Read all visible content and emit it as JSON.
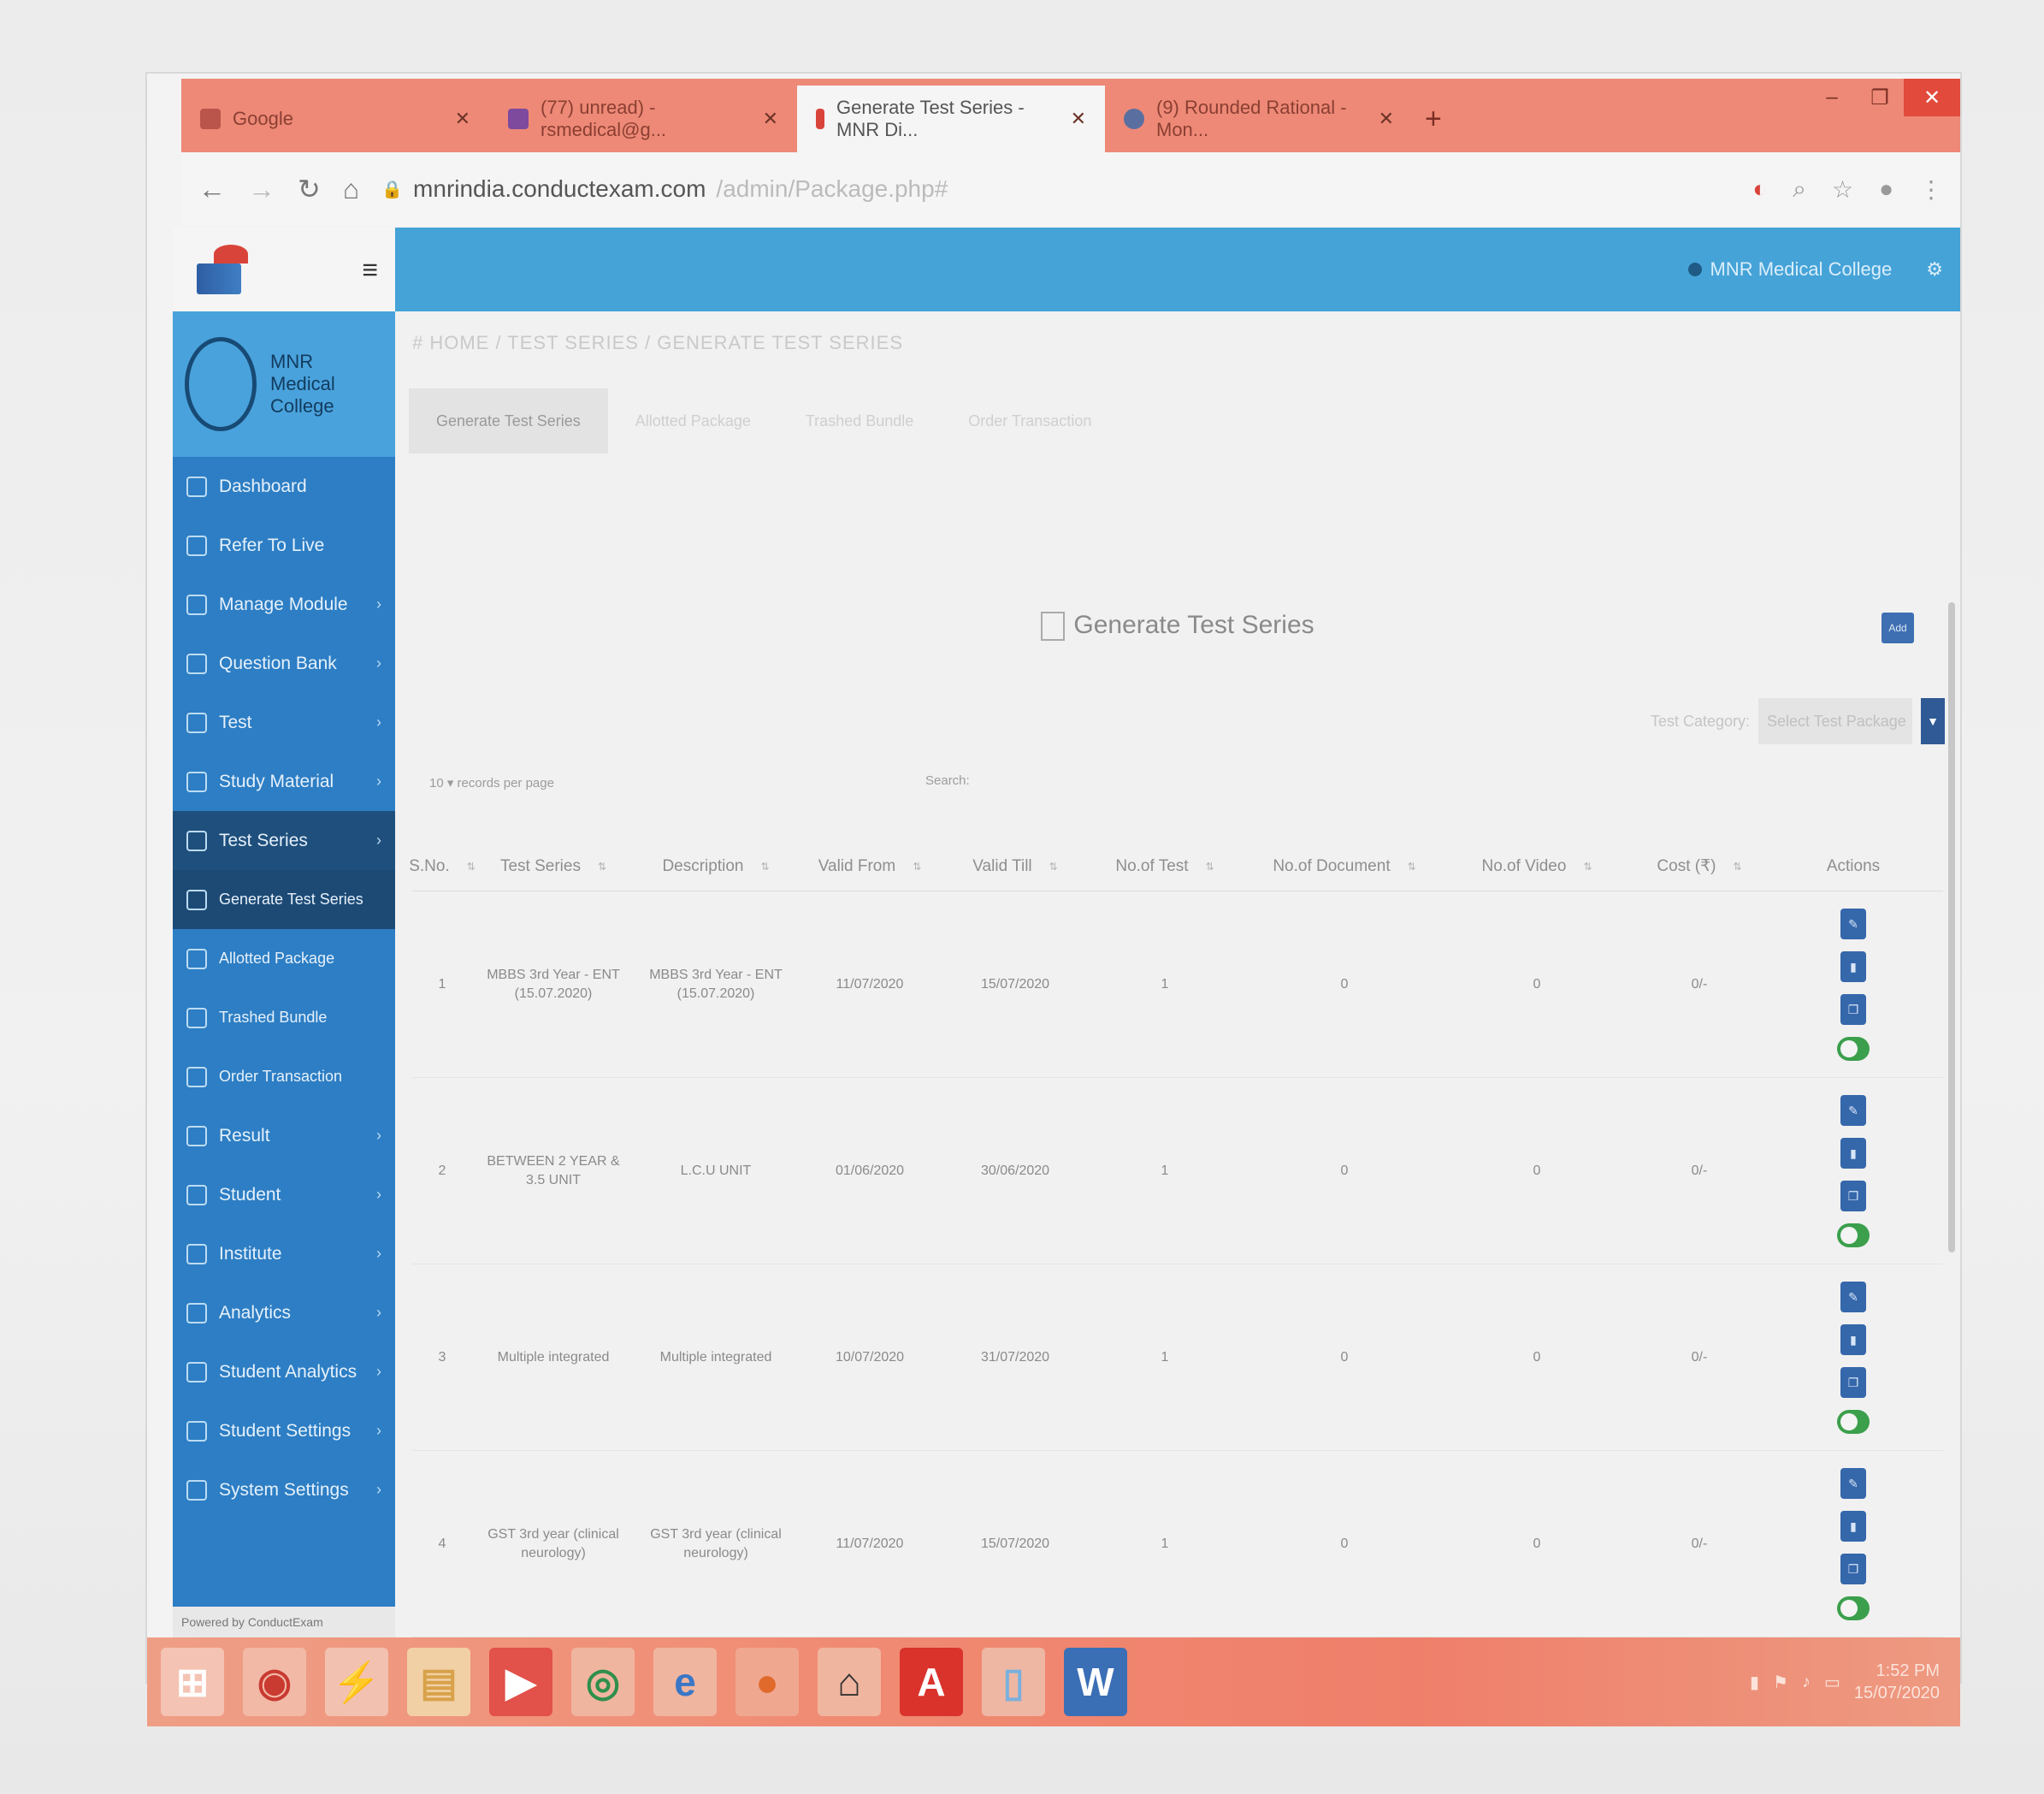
{
  "browser": {
    "tabs": [
      {
        "label": "Google",
        "active": false
      },
      {
        "label": "(77) unread) - rsmedical@g...",
        "active": false
      },
      {
        "label": "Generate Test Series - MNR Di...",
        "active": true
      },
      {
        "label": "(9) Rounded Rational - Mon...",
        "active": false
      }
    ],
    "new_tab": "+",
    "url_host": "mnrindia.conductexam.com",
    "url_path": "/admin/Package.php#"
  },
  "app": {
    "topbar_user": "MNR Medical College",
    "profile_name": "MNR Medical College",
    "breadcrumb": "# HOME / TEST SERIES / GENERATE TEST SERIES",
    "content_tabs": [
      {
        "label": "Generate Test Series",
        "active": true
      },
      {
        "label": "Allotted Package",
        "active": false
      },
      {
        "label": "Trashed Bundle",
        "active": false
      },
      {
        "label": "Order Transaction",
        "active": false
      }
    ],
    "panel_title": "Generate Test Series",
    "add_label": "Add",
    "test_category_label": "Test Category:",
    "test_category_value": "Select Test Package",
    "records_label": "10 ▾ records per page",
    "search_label": "Search:"
  },
  "sidebar": {
    "items": [
      {
        "label": "Dashboard",
        "chev": false,
        "style": "normal"
      },
      {
        "label": "Refer To Live",
        "chev": false,
        "style": "normal"
      },
      {
        "label": "Manage Module",
        "chev": true,
        "style": "normal"
      },
      {
        "label": "Question Bank",
        "chev": true,
        "style": "normal"
      },
      {
        "label": "Test",
        "chev": true,
        "style": "normal"
      },
      {
        "label": "Study Material",
        "chev": true,
        "style": "normal"
      },
      {
        "label": "Test Series",
        "chev": true,
        "style": "active"
      },
      {
        "label": "Generate Test Series",
        "chev": false,
        "style": "sub"
      },
      {
        "label": "Allotted Package",
        "chev": false,
        "style": "sub2"
      },
      {
        "label": "Trashed Bundle",
        "chev": false,
        "style": "sub2"
      },
      {
        "label": "Order Transaction",
        "chev": false,
        "style": "sub2"
      },
      {
        "label": "Result",
        "chev": true,
        "style": "normal"
      },
      {
        "label": "Student",
        "chev": true,
        "style": "normal"
      },
      {
        "label": "Institute",
        "chev": true,
        "style": "normal"
      },
      {
        "label": "Analytics",
        "chev": true,
        "style": "normal"
      },
      {
        "label": "Student Analytics",
        "chev": true,
        "style": "normal"
      },
      {
        "label": "Student Settings",
        "chev": true,
        "style": "normal"
      },
      {
        "label": "System Settings",
        "chev": true,
        "style": "normal"
      }
    ],
    "footer": "Powered by ConductExam"
  },
  "table": {
    "headers": [
      "S.No.",
      "Test Series",
      "Description",
      "Valid From",
      "Valid Till",
      "No.of Test",
      "No.of Document",
      "No.of Video",
      "Cost (₹)",
      "Actions"
    ],
    "rows": [
      {
        "sno": "1",
        "series": "MBBS 3rd Year - ENT (15.07.2020)",
        "desc": "MBBS 3rd Year - ENT (15.07.2020)",
        "from": "11/07/2020",
        "till": "15/07/2020",
        "tests": "1",
        "docs": "0",
        "videos": "0",
        "cost": "0/-"
      },
      {
        "sno": "2",
        "series": "BETWEEN 2 YEAR & 3.5 UNIT",
        "desc": "L.C.U UNIT",
        "from": "01/06/2020",
        "till": "30/06/2020",
        "tests": "1",
        "docs": "0",
        "videos": "0",
        "cost": "0/-"
      },
      {
        "sno": "3",
        "series": "Multiple integrated",
        "desc": "Multiple integrated",
        "from": "10/07/2020",
        "till": "31/07/2020",
        "tests": "1",
        "docs": "0",
        "videos": "0",
        "cost": "0/-"
      },
      {
        "sno": "4",
        "series": "GST 3rd year (clinical neurology)",
        "desc": "GST 3rd year (clinical neurology)",
        "from": "11/07/2020",
        "till": "15/07/2020",
        "tests": "1",
        "docs": "0",
        "videos": "0",
        "cost": "0/-"
      }
    ]
  },
  "taskbar": {
    "icons": [
      {
        "name": "windows-start-icon",
        "glyph": "⊞",
        "bg": "#f4c3b3",
        "fg": "#ffffff"
      },
      {
        "name": "app-badge-icon",
        "glyph": "◉",
        "bg": "#f2b9a6",
        "fg": "#c93a31"
      },
      {
        "name": "runner-app-icon",
        "glyph": "⚡",
        "bg": "#f3c1b0",
        "fg": "#222222"
      },
      {
        "name": "folder-icon",
        "glyph": "▤",
        "bg": "#f2d0a6",
        "fg": "#d8a24a"
      },
      {
        "name": "media-player-icon",
        "glyph": "▶",
        "bg": "#e2514a",
        "fg": "#ffffff"
      },
      {
        "name": "chrome-icon",
        "glyph": "◎",
        "bg": "#f0b59f",
        "fg": "#2f8f4c"
      },
      {
        "name": "ie-icon",
        "glyph": "e",
        "bg": "#f0b59f",
        "fg": "#3a77c6"
      },
      {
        "name": "firefox-icon",
        "glyph": "●",
        "bg": "#f0a78f",
        "fg": "#e06a2b"
      },
      {
        "name": "scanner-icon",
        "glyph": "⌂",
        "bg": "#f0b59f",
        "fg": "#333333"
      },
      {
        "name": "acrobat-icon",
        "glyph": "A",
        "bg": "#d9332c",
        "fg": "#ffffff"
      },
      {
        "name": "notepad-icon",
        "glyph": "▯",
        "bg": "#eeb7a4",
        "fg": "#7ab0dc"
      },
      {
        "name": "word-icon",
        "glyph": "W",
        "bg": "#3b6fb5",
        "fg": "#ffffff"
      }
    ],
    "time": "1:52 PM",
    "date": "15/07/2020"
  }
}
